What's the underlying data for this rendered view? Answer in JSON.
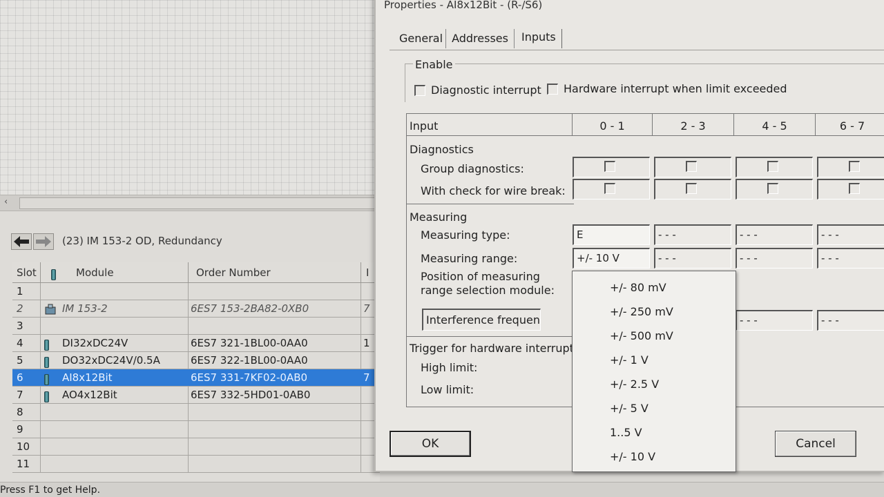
{
  "dialog": {
    "title": "Properties - AI8x12Bit - (R-/S6)",
    "tabs": [
      {
        "label": "General"
      },
      {
        "label": "Addresses"
      },
      {
        "label": "Inputs"
      }
    ],
    "enable": {
      "label": "Enable",
      "diagnostic_interrupt": "Diagnostic interrupt",
      "hardware_interrupt": "Hardware interrupt when limit exceeded"
    },
    "grid": {
      "input_header": "Input",
      "columns": [
        "0 - 1",
        "2 - 3",
        "4 - 5",
        "6 - 7"
      ],
      "diagnostics_label": "Diagnostics",
      "group_diagnostics": "Group diagnostics:",
      "wire_break": "With check for wire break:",
      "measuring_label": "Measuring",
      "measuring_type": "Measuring type:",
      "measuring_range": "Measuring range:",
      "position_line1": "Position of measuring",
      "position_line2": "range selection module:",
      "interference": "Interference frequency",
      "trigger_label": "Trigger for hardware interrupt",
      "high_limit": "High limit:",
      "low_limit": "Low limit:",
      "type_values": [
        "E",
        "- - -",
        "- - -",
        "- - -"
      ],
      "range_values": [
        "+/- 10 V",
        "- - -",
        "- - -",
        "- - -"
      ],
      "interference_values": [
        "- - -",
        "- - -"
      ]
    },
    "buttons": {
      "ok": "OK",
      "cancel": "Cancel"
    }
  },
  "dropdown": {
    "options": [
      "+/- 80 mV",
      "+/- 250 mV",
      "+/- 500 mV",
      "+/- 1 V",
      "+/- 2.5 V",
      "+/- 5 V",
      "1..5 V",
      "+/- 10 V"
    ]
  },
  "station": {
    "title": "(23)  IM 153-2 OD, Redundancy",
    "headers": {
      "slot": "Slot",
      "module": "Module",
      "order": "Order Number",
      "extra": "I"
    },
    "rows": [
      {
        "slot": "1",
        "module": "",
        "order": "",
        "extra": ""
      },
      {
        "slot": "2",
        "module": "IM 153-2",
        "order": "6ES7 153-2BA82-0XB0",
        "extra": "7"
      },
      {
        "slot": "3",
        "module": "",
        "order": "",
        "extra": ""
      },
      {
        "slot": "4",
        "module": "DI32xDC24V",
        "order": "6ES7 321-1BL00-0AA0",
        "extra": "1"
      },
      {
        "slot": "5",
        "module": "DO32xDC24V/0.5A",
        "order": "6ES7 322-1BL00-0AA0",
        "extra": ""
      },
      {
        "slot": "6",
        "module": "AI8x12Bit",
        "order": "6ES7 331-7KF02-0AB0",
        "extra": "7"
      },
      {
        "slot": "7",
        "module": "AO4x12Bit",
        "order": "6ES7 332-5HD01-0AB0",
        "extra": ""
      },
      {
        "slot": "8",
        "module": "",
        "order": "",
        "extra": ""
      },
      {
        "slot": "9",
        "module": "",
        "order": "",
        "extra": ""
      },
      {
        "slot": "10",
        "module": "",
        "order": "",
        "extra": ""
      },
      {
        "slot": "11",
        "module": "",
        "order": "",
        "extra": ""
      }
    ],
    "scroll_arrow": "‹"
  },
  "status_bar": {
    "text": "Press F1 to get Help."
  },
  "colors": {
    "selection": "#2e7bd6",
    "module_icon": "#4c9aa1"
  }
}
